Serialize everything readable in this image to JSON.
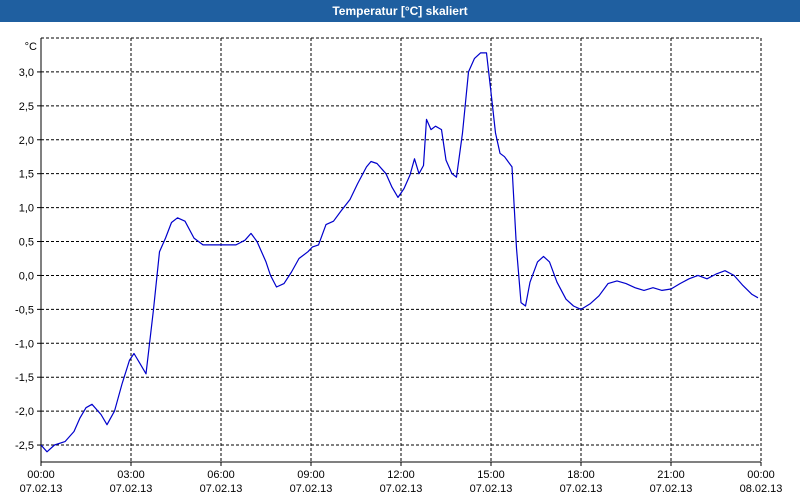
{
  "window": {
    "title": "Temperatur [°C] skaliert"
  },
  "chart_data": {
    "type": "line",
    "title": "Temperatur [°C] skaliert",
    "ylabel": "°C",
    "xlabel": "",
    "ylim": [
      -2.75,
      3.5
    ],
    "xlim": [
      0,
      24
    ],
    "grid": true,
    "y_ticks": [
      3.0,
      2.5,
      2.0,
      1.5,
      1.0,
      0.5,
      0.0,
      -0.5,
      -1.0,
      -1.5,
      -2.0,
      -2.5
    ],
    "y_tick_labels": [
      "3,0",
      "2,5",
      "2,0",
      "1,5",
      "1,0",
      "0,5",
      "0,0",
      "-0,5",
      "-1,0",
      "-1,5",
      "-2,0",
      "-2,5"
    ],
    "x_ticks": [
      {
        "hour": 0,
        "time": "00:00",
        "date": "07.02.13"
      },
      {
        "hour": 3,
        "time": "03:00",
        "date": "07.02.13"
      },
      {
        "hour": 6,
        "time": "06:00",
        "date": "07.02.13"
      },
      {
        "hour": 9,
        "time": "09:00",
        "date": "07.02.13"
      },
      {
        "hour": 12,
        "time": "12:00",
        "date": "07.02.13"
      },
      {
        "hour": 15,
        "time": "15:00",
        "date": "07.02.13"
      },
      {
        "hour": 18,
        "time": "18:00",
        "date": "07.02.13"
      },
      {
        "hour": 21,
        "time": "21:00",
        "date": "07.02.13"
      },
      {
        "hour": 24,
        "time": "00:00",
        "date": "08.02.13"
      }
    ],
    "series": [
      {
        "color": "#0000cc",
        "x": [
          0,
          0.2,
          0.45,
          0.8,
          1.1,
          1.3,
          1.5,
          1.7,
          2.0,
          2.2,
          2.45,
          2.7,
          2.95,
          3.1,
          3.3,
          3.5,
          3.75,
          3.95,
          4.15,
          4.35,
          4.55,
          4.8,
          5.1,
          5.4,
          5.8,
          6.2,
          6.5,
          6.8,
          7.0,
          7.2,
          7.5,
          7.65,
          7.85,
          8.1,
          8.35,
          8.6,
          8.9,
          9.05,
          9.25,
          9.5,
          9.75,
          10.0,
          10.3,
          10.55,
          10.85,
          11.0,
          11.2,
          11.5,
          11.7,
          11.9,
          12.1,
          12.3,
          12.45,
          12.6,
          12.75,
          12.85,
          13.0,
          13.15,
          13.35,
          13.5,
          13.7,
          13.85,
          14.05,
          14.25,
          14.45,
          14.65,
          14.85,
          15.0,
          15.15,
          15.3,
          15.45,
          15.7,
          15.85,
          16.0,
          16.15,
          16.3,
          16.55,
          16.75,
          16.95,
          17.2,
          17.5,
          17.75,
          18.0,
          18.3,
          18.6,
          18.9,
          19.2,
          19.5,
          19.8,
          20.1,
          20.4,
          20.7,
          21.0,
          21.3,
          21.6,
          21.9,
          22.2,
          22.5,
          22.8,
          23.1,
          23.4,
          23.7,
          23.9
        ],
        "values": [
          -2.5,
          -2.6,
          -2.5,
          -2.45,
          -2.3,
          -2.1,
          -1.95,
          -1.9,
          -2.05,
          -2.2,
          -2.0,
          -1.6,
          -1.25,
          -1.15,
          -1.3,
          -1.45,
          -0.5,
          0.35,
          0.55,
          0.78,
          0.85,
          0.8,
          0.55,
          0.45,
          0.45,
          0.45,
          0.45,
          0.52,
          0.62,
          0.5,
          0.2,
          0.0,
          -0.17,
          -0.12,
          0.05,
          0.25,
          0.35,
          0.42,
          0.45,
          0.75,
          0.8,
          0.95,
          1.12,
          1.35,
          1.6,
          1.68,
          1.65,
          1.5,
          1.3,
          1.15,
          1.28,
          1.48,
          1.72,
          1.5,
          1.62,
          2.3,
          2.15,
          2.2,
          2.15,
          1.7,
          1.5,
          1.45,
          2.1,
          3.0,
          3.2,
          3.28,
          3.28,
          2.7,
          2.1,
          1.8,
          1.75,
          1.6,
          0.4,
          -0.4,
          -0.45,
          -0.1,
          0.2,
          0.28,
          0.2,
          -0.1,
          -0.35,
          -0.45,
          -0.5,
          -0.42,
          -0.3,
          -0.12,
          -0.08,
          -0.12,
          -0.18,
          -0.22,
          -0.18,
          -0.22,
          -0.2,
          -0.12,
          -0.05,
          0.0,
          -0.05,
          0.02,
          0.07,
          0.0,
          -0.15,
          -0.28,
          -0.33
        ]
      }
    ]
  }
}
